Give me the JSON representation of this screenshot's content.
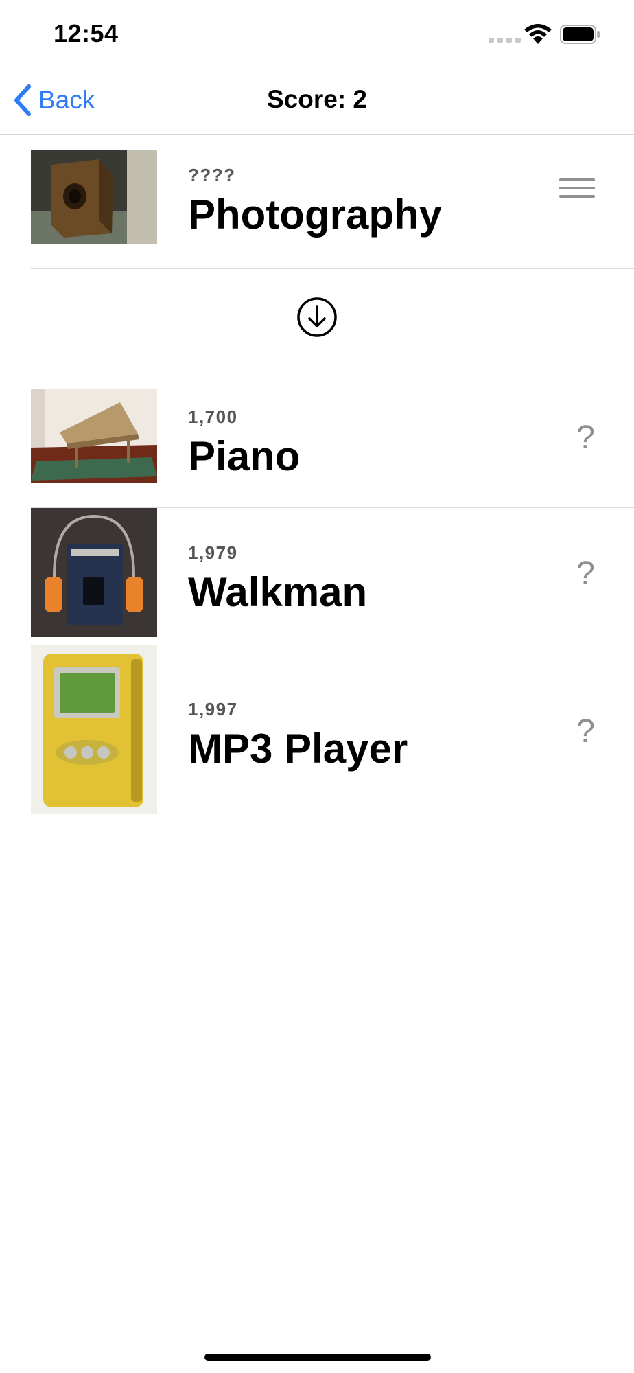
{
  "status_bar": {
    "time": "12:54",
    "icons": [
      "signal-icon",
      "wifi-icon",
      "battery-icon"
    ]
  },
  "nav": {
    "back_label": "Back",
    "title": "Score: 2"
  },
  "current_card": {
    "year": "????",
    "title": "Photography",
    "image": "box camera"
  },
  "drop_target_icon": "arrow-down-circle-icon",
  "timeline": [
    {
      "year": "1,700",
      "title": "Piano",
      "status": "?",
      "image": "piano"
    },
    {
      "year": "1,979",
      "title": "Walkman",
      "status": "?",
      "image": "walkman"
    },
    {
      "year": "1,997",
      "title": "MP3 Player",
      "status": "?",
      "image": "mp3 player"
    }
  ],
  "colors": {
    "accent": "#2f7cf6",
    "separator": "#d9d9dc",
    "muted": "#8e8e93"
  }
}
